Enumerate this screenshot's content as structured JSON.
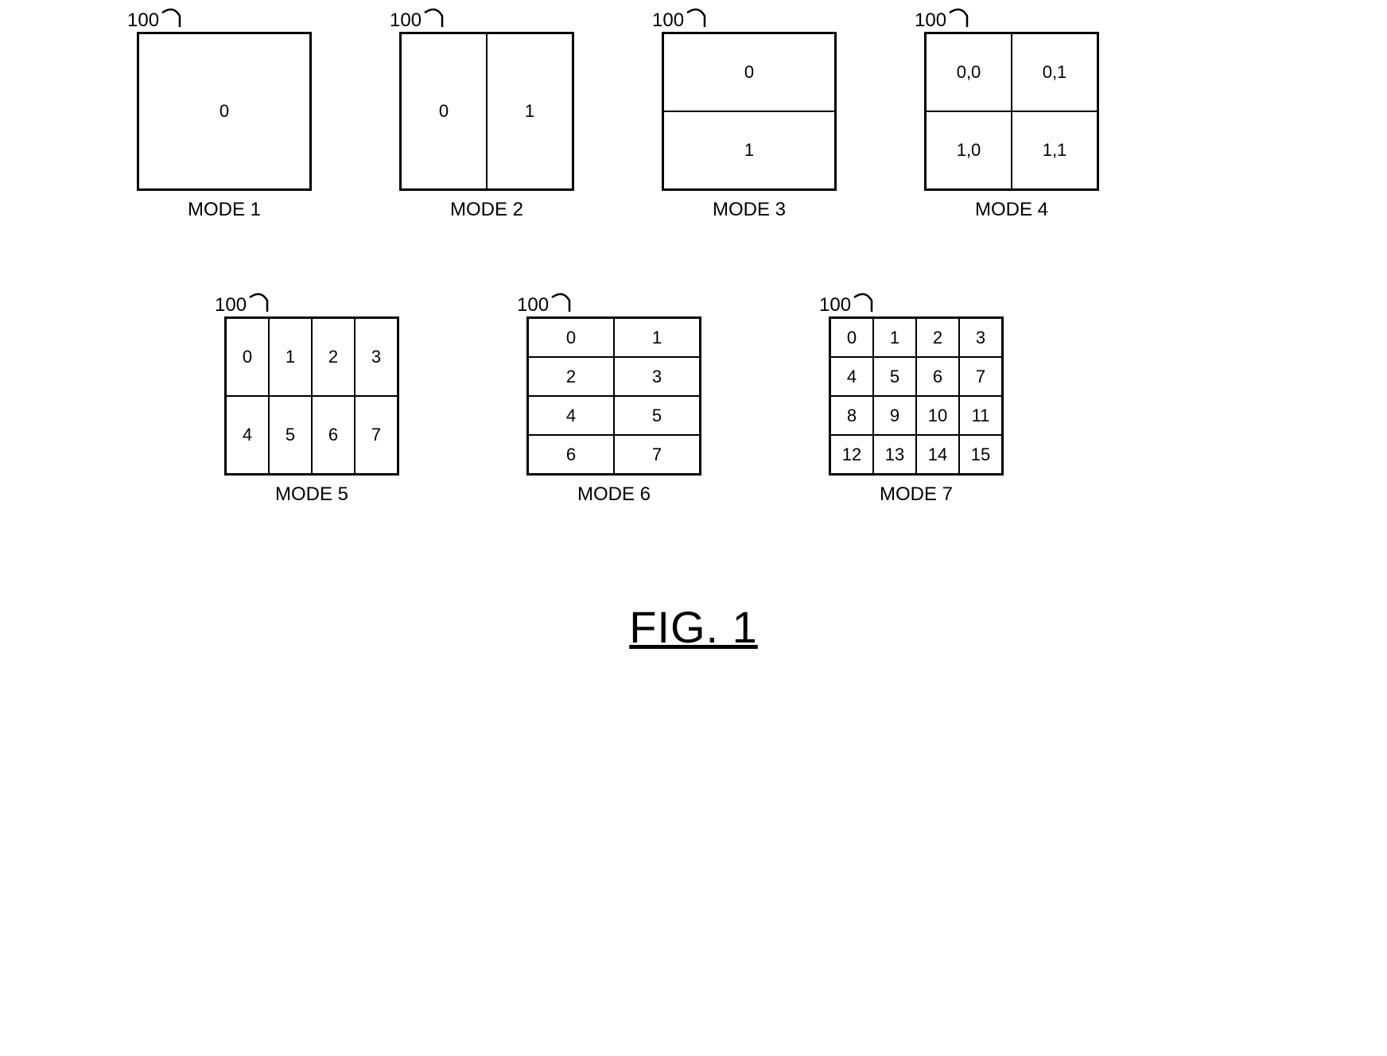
{
  "figure_title": "FIG. 1",
  "ref_label": "100",
  "modes": [
    {
      "caption": "MODE 1",
      "rows": 1,
      "cols": 1,
      "cells": [
        "0"
      ],
      "size": "sz-large"
    },
    {
      "caption": "MODE 2",
      "rows": 1,
      "cols": 2,
      "cells": [
        "0",
        "1"
      ],
      "size": "sz-large"
    },
    {
      "caption": "MODE 3",
      "rows": 2,
      "cols": 1,
      "cells": [
        "0",
        "1"
      ],
      "size": "sz-large"
    },
    {
      "caption": "MODE 4",
      "rows": 2,
      "cols": 2,
      "cells": [
        "0,0",
        "0,1",
        "1,0",
        "1,1"
      ],
      "size": "sz-large"
    },
    {
      "caption": "MODE 5",
      "rows": 2,
      "cols": 4,
      "cells": [
        "0",
        "1",
        "2",
        "3",
        "4",
        "5",
        "6",
        "7"
      ],
      "size": "sz-med"
    },
    {
      "caption": "MODE 6",
      "rows": 4,
      "cols": 2,
      "cells": [
        "0",
        "1",
        "2",
        "3",
        "4",
        "5",
        "6",
        "7"
      ],
      "size": "sz-med"
    },
    {
      "caption": "MODE 7",
      "rows": 4,
      "cols": 4,
      "cells": [
        "0",
        "1",
        "2",
        "3",
        "4",
        "5",
        "6",
        "7",
        "8",
        "9",
        "10",
        "11",
        "12",
        "13",
        "14",
        "15"
      ],
      "size": "sz-small"
    }
  ]
}
